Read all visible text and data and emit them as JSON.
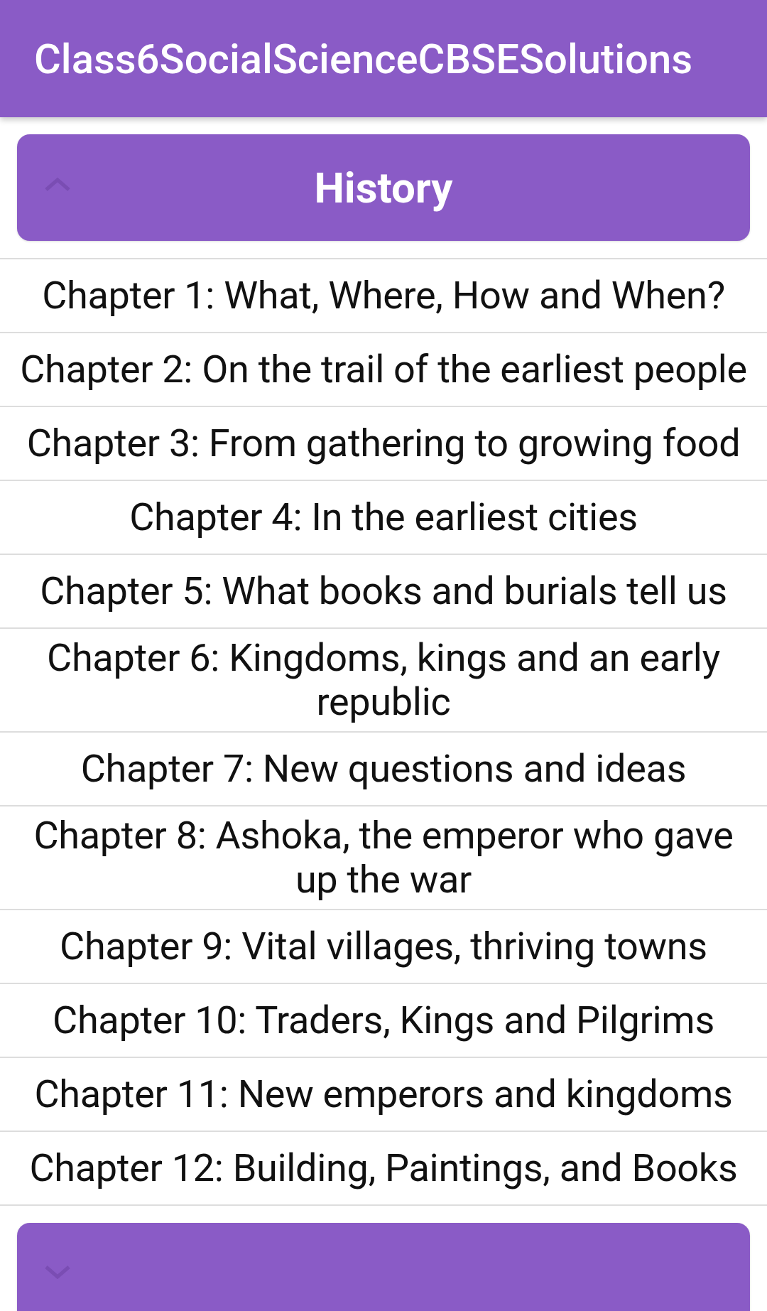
{
  "app_bar": {
    "title": "Class6SocialScienceCBSESolutions"
  },
  "sections": [
    {
      "title": "History",
      "expanded": true,
      "chapters": [
        "Chapter 1: What, Where, How and When?",
        "Chapter 2: On the trail of the earliest people",
        "Chapter 3: From gathering to growing food",
        "Chapter 4: In the earliest cities",
        "Chapter 5: What books and burials tell us",
        "Chapter 6: Kingdoms, kings and an early republic",
        "Chapter 7: New questions and ideas",
        "Chapter 8: Ashoka, the emperor who gave up the war",
        "Chapter 9: Vital villages, thriving towns",
        "Chapter 10: Traders, Kings and Pilgrims",
        "Chapter 11: New emperors and kingdoms",
        "Chapter 12: Building, Paintings, and Books"
      ]
    },
    {
      "expanded": false
    }
  ]
}
